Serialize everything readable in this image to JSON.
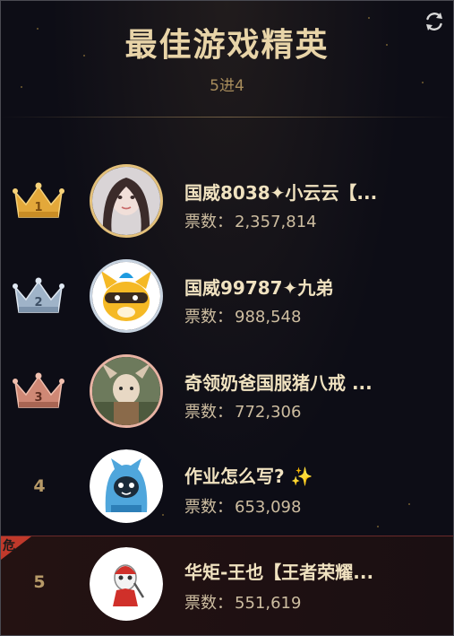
{
  "header": {
    "title": "最佳游戏精英",
    "subtitle": "5进4",
    "refresh_icon": "refresh-icon"
  },
  "colors": {
    "gold": "#e3b04b",
    "silver": "#aebfd2",
    "bronze": "#d18c7a",
    "title": "#e8d4a8",
    "danger": "#c0392b"
  },
  "votes_label": "票数：",
  "danger_label": "危",
  "entries": [
    {
      "rank": "1",
      "name": "国威8038✦小云云【...",
      "votes": "2,357,814",
      "crown": "gold-crown-icon"
    },
    {
      "rank": "2",
      "name": "国威99787✦九弟",
      "votes": "988,548",
      "crown": "silver-crown-icon"
    },
    {
      "rank": "3",
      "name": "奇领奶爸国服猪八戒 ...",
      "votes": "772,306",
      "crown": "bronze-crown-icon"
    },
    {
      "rank": "4",
      "name": "作业怎么写? ✨",
      "votes": "653,098"
    },
    {
      "rank": "5",
      "name": "华矩-王也【王者荣耀...",
      "votes": "551,619"
    }
  ]
}
